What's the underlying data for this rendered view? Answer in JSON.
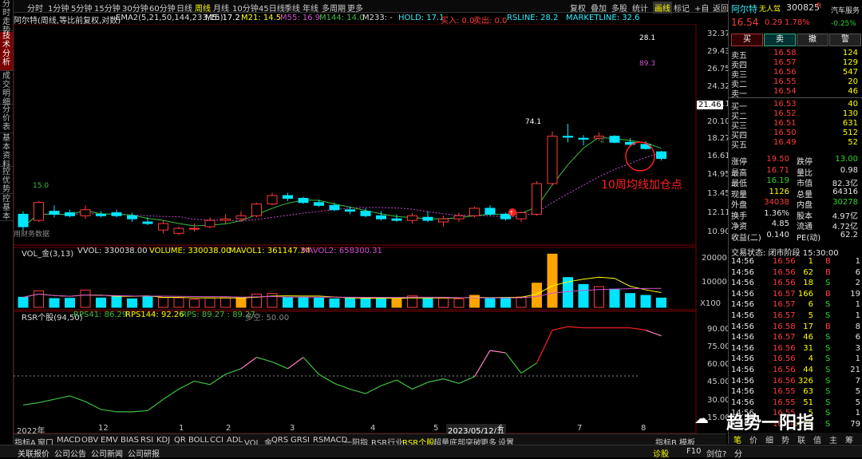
{
  "left_tabs": [
    {
      "label": "分时走势",
      "active": false
    },
    {
      "label": "技术分析",
      "active": true
    },
    {
      "label": "成交明细",
      "active": false
    },
    {
      "label": "分价表",
      "active": false
    },
    {
      "label": "基本资料",
      "active": false
    },
    {
      "label": "控优势",
      "active": false
    },
    {
      "label": "控基本",
      "active": false
    }
  ],
  "toolbar": {
    "periods": [
      "分时",
      "1分钟",
      "5分钟",
      "15分钟",
      "30分钟",
      "60分钟",
      "日线",
      "周线",
      "月线",
      "10分钟",
      "45日线",
      "季线",
      "年线",
      "多周期",
      "更多"
    ],
    "selected_period": "周线",
    "right_buttons": [
      "复权",
      "叠加",
      "多股",
      "统计",
      "画线",
      "标记",
      "+自",
      "返回"
    ]
  },
  "info": {
    "stock": "阿尔特(周线,等比前复权,对数)",
    "ema": "EMA2(5,21,50,144,233,15)",
    "m5": "M5: 17.2",
    "m21": "M21: 14.5",
    "m55": "M55: 16.9",
    "m144": "M144: 14.0",
    "m233": "M233: -",
    "hold": "HOLD: 17.1",
    "buy": "买入: 0.0",
    "sell": "卖出: 0.0",
    "rsline": "RSLINE: 28.2",
    "marketline": "MARKETLINE: 32.6"
  },
  "annotations": {
    "top_val1": "28.1",
    "top_val2": "89.3",
    "peak": "74.1",
    "left_label": "15.0",
    "watermark": "用财务数据",
    "callout": "10周均线加仓点",
    "current_price": "21.46",
    "current_price2": "16.61"
  },
  "price_axis": [
    "32.37",
    "29.43",
    "26.75",
    "24.32",
    "22.11",
    "20.10",
    "18.27",
    "16.61",
    "14.95",
    "13.45",
    "12.11",
    "10.90"
  ],
  "vol_info": {
    "name": "VOL_金(3,13)",
    "vvol": "VVOL: 330038.00",
    "volume": "VOLUME: 330038.00",
    "mavol1": "MAVOL1: 361147.34",
    "mavol2": "MAVOL2: 658300.31"
  },
  "vol_axis": [
    "20000",
    "10000",
    "X100"
  ],
  "rsr_info": {
    "name": "RSR个股(94,50)",
    "rps41": "RPS41: 86.29",
    "rps144": "RPS144: 92.26",
    "rps": "RPS: 89.27 : 89.27",
    "ref": "多空: 50.00"
  },
  "rsr_axis": [
    "90.00",
    "75.00",
    "60.00",
    "45.00",
    "30.00",
    "15.00"
  ],
  "time_axis": [
    "2022年",
    "12",
    "1",
    "2",
    "3",
    "4",
    "5",
    "2023/05/12/五",
    "6",
    "7",
    "8"
  ],
  "ind_tabs": [
    "指标A",
    "窗口",
    "MACD",
    "OBV",
    "EMV",
    "BIAS",
    "RSI",
    "KDJ",
    "QR",
    "BOLL",
    "CCI",
    "ADL",
    "VOL_金",
    "QRS",
    "GRSI",
    "RSMACD",
    "一阳指",
    "RSR行业",
    "RSR个股",
    "超量底部突破",
    "更多",
    "设置"
  ],
  "ind_tabs_selected": "RSR个股",
  "ind_right": [
    "指标B",
    "模板"
  ],
  "quote": {
    "name": "阿尔特",
    "tag": "无人驾",
    "code": "300825",
    "r_mark": "R",
    "sector": "汽车服务",
    "sector_chg": "-0.25%",
    "price": "16.54",
    "change": "0.29",
    "pct": "1.78%",
    "trade_buttons": [
      "买",
      "卖",
      "撤",
      "警"
    ],
    "sells": [
      {
        "label": "卖五",
        "price": "16.58",
        "vol": "124"
      },
      {
        "label": "卖四",
        "price": "16.57",
        "vol": "129"
      },
      {
        "label": "卖三",
        "price": "16.56",
        "vol": "547"
      },
      {
        "label": "卖二",
        "price": "16.55",
        "vol": "20"
      },
      {
        "label": "卖一",
        "price": "16.54",
        "vol": "46"
      }
    ],
    "buys": [
      {
        "label": "买一",
        "price": "16.53",
        "vol": "40"
      },
      {
        "label": "买二",
        "price": "16.52",
        "vol": "130"
      },
      {
        "label": "买三",
        "price": "16.51",
        "vol": "631"
      },
      {
        "label": "买四",
        "price": "16.50",
        "vol": "512"
      },
      {
        "label": "买五",
        "price": "16.49",
        "vol": "52"
      }
    ],
    "stats": [
      {
        "l1": "涨停",
        "v1": "19.50",
        "l2": "跌停",
        "v2": "13.00",
        "c1": "red",
        "c2": "grn"
      },
      {
        "l1": "最高",
        "v1": "16.71",
        "l2": "量比",
        "v2": "0.98",
        "c1": "red",
        "c2": "wht"
      },
      {
        "l1": "最低",
        "v1": "16.19",
        "l2": "市值",
        "v2": "82.3亿",
        "c1": "grn",
        "c2": "wht"
      },
      {
        "l1": "现量",
        "v1": "1126",
        "l2": "总量",
        "v2": "64316",
        "c1": "yel",
        "c2": "wht"
      },
      {
        "l1": "外盘",
        "v1": "34038",
        "l2": "内盘",
        "v2": "30278",
        "c1": "red",
        "c2": "grn"
      },
      {
        "l1": "换手",
        "v1": "1.36%",
        "l2": "股本",
        "v2": "4.97亿",
        "c1": "wht",
        "c2": "wht"
      },
      {
        "l1": "净资",
        "v1": "4.85",
        "l2": "流通",
        "v2": "4.72亿",
        "c1": "wht",
        "c2": "wht"
      },
      {
        "l1": "收益(二)",
        "v1": "0.140",
        "l2": "PE(动)",
        "v2": "62.2",
        "c1": "wht",
        "c2": "wht"
      }
    ],
    "trade_status": "交易状态: 闭市阶段 15:30:00",
    "ticks": [
      {
        "t": "14:56",
        "p": "16.56",
        "v": "1",
        "s": "B",
        "n": "1"
      },
      {
        "t": "14:56",
        "p": "16.56",
        "v": "62",
        "s": "B",
        "n": "6"
      },
      {
        "t": "14:56",
        "p": "16.56",
        "v": "18",
        "s": "S",
        "n": "2"
      },
      {
        "t": "14:56",
        "p": "16.57",
        "v": "166",
        "s": "B",
        "n": "19"
      },
      {
        "t": "14:56",
        "p": "16.57",
        "v": "6",
        "s": "S",
        "n": "1"
      },
      {
        "t": "14:56",
        "p": "16.57",
        "v": "5",
        "s": "S",
        "n": "1"
      },
      {
        "t": "14:56",
        "p": "16.58",
        "v": "17",
        "s": "B",
        "n": "8"
      },
      {
        "t": "14:56",
        "p": "16.57",
        "v": "46",
        "s": "S",
        "n": "6"
      },
      {
        "t": "14:56",
        "p": "16.56",
        "v": "31",
        "s": "S",
        "n": "3"
      },
      {
        "t": "14:56",
        "p": "16.56",
        "v": "4",
        "s": "S",
        "n": "1"
      },
      {
        "t": "14:56",
        "p": "16.56",
        "v": "44",
        "s": "S",
        "n": "21"
      },
      {
        "t": "14:56",
        "p": "16.56",
        "v": "326",
        "s": "S",
        "n": "7"
      },
      {
        "t": "14:56",
        "p": "16.55",
        "v": "63",
        "s": "S",
        "n": "5"
      },
      {
        "t": "14:56",
        "p": "16.55",
        "v": "51",
        "s": "S",
        "n": "5"
      },
      {
        "t": "14:56",
        "p": "16.55",
        "v": "5",
        "s": "S",
        "n": "1"
      },
      {
        "t": "15:00",
        "p": "16.54",
        "v": "1126",
        "s": "S",
        "n": "79"
      }
    ],
    "bottom_tabs": [
      "笔",
      "价",
      "细",
      "势",
      "联",
      "值",
      "主",
      "筹"
    ]
  },
  "status": {
    "items": [
      "关联报价",
      "公司公告",
      "公司新闻",
      "公司研报"
    ],
    "right": [
      "诊股",
      "F10",
      "剑位?",
      "分"
    ]
  },
  "watermark_account": "趋势一阳指",
  "colors": {
    "up": "#ff3b3b",
    "down": "#00e5ff",
    "vol_hl": "#ffa500",
    "ma10": "#c050d0",
    "ma_green": "#3fbf3f",
    "rps_green": "#3fbf3f",
    "rps_pink": "#ff80c0",
    "rps_red": "#ff2020"
  },
  "chart_data": {
    "type": "candlestick",
    "weeks": [
      "2022-11-04",
      "2022-11-11",
      "2022-11-18",
      "2022-11-25",
      "2022-12-02",
      "2022-12-09",
      "2022-12-16",
      "2022-12-23",
      "2022-12-30",
      "2023-01-06",
      "2023-01-13",
      "2023-01-20",
      "2023-02-03",
      "2023-02-10",
      "2023-02-17",
      "2023-02-24",
      "2023-03-03",
      "2023-03-10",
      "2023-03-17",
      "2023-03-24",
      "2023-03-31",
      "2023-04-07",
      "2023-04-14",
      "2023-04-21",
      "2023-04-28",
      "2023-05-05",
      "2023-05-12",
      "2023-05-19",
      "2023-05-26",
      "2023-06-02",
      "2023-06-09",
      "2023-06-16",
      "2023-06-21",
      "2023-06-30",
      "2023-07-07",
      "2023-07-14",
      "2023-07-21",
      "2023-07-28",
      "2023-08-04",
      "2023-08-11",
      "2023-08-18",
      "2023-08-25"
    ],
    "ohlc": [
      [
        12.4,
        12.6,
        11.4,
        11.6
      ],
      [
        12.0,
        13.3,
        11.9,
        13.2
      ],
      [
        12.6,
        13.0,
        12.2,
        12.4
      ],
      [
        12.5,
        12.7,
        12.2,
        12.3
      ],
      [
        12.3,
        13.0,
        12.1,
        12.7
      ],
      [
        12.4,
        12.6,
        12.2,
        12.3
      ],
      [
        12.5,
        12.7,
        12.2,
        12.3
      ],
      [
        12.3,
        12.5,
        11.9,
        12.1
      ],
      [
        11.9,
        12.2,
        11.7,
        11.8
      ],
      [
        11.4,
        12.0,
        11.2,
        11.8
      ],
      [
        11.2,
        11.6,
        11.1,
        11.5
      ],
      [
        11.5,
        11.8,
        11.3,
        11.5
      ],
      [
        11.6,
        12.2,
        11.5,
        12.0
      ],
      [
        12.0,
        12.4,
        11.8,
        12.1
      ],
      [
        12.1,
        12.6,
        11.9,
        12.3
      ],
      [
        12.3,
        13.2,
        12.2,
        13.1
      ],
      [
        13.1,
        13.9,
        13.0,
        13.7
      ],
      [
        13.7,
        13.9,
        13.3,
        13.5
      ],
      [
        13.5,
        13.6,
        13.1,
        13.2
      ],
      [
        13.2,
        13.4,
        12.9,
        13.0
      ],
      [
        13.0,
        13.2,
        12.6,
        12.7
      ],
      [
        12.7,
        12.9,
        12.4,
        12.6
      ],
      [
        12.6,
        12.8,
        12.2,
        12.3
      ],
      [
        12.3,
        12.6,
        12.0,
        12.1
      ],
      [
        12.1,
        12.4,
        11.9,
        12.0
      ],
      [
        12.0,
        12.5,
        11.8,
        12.3
      ],
      [
        12.2,
        12.6,
        11.9,
        12.0
      ],
      [
        11.9,
        12.3,
        11.6,
        12.1
      ],
      [
        12.1,
        12.5,
        11.9,
        12.3
      ],
      [
        12.3,
        12.9,
        12.2,
        12.8
      ],
      [
        12.8,
        13.0,
        12.3,
        12.4
      ],
      [
        12.4,
        12.5,
        12.0,
        12.1
      ],
      [
        12.1,
        12.6,
        11.9,
        12.5
      ],
      [
        12.4,
        14.8,
        12.3,
        14.6
      ],
      [
        14.6,
        19.3,
        14.5,
        18.8
      ],
      [
        18.8,
        20.1,
        18.2,
        18.7
      ],
      [
        18.6,
        18.9,
        17.9,
        18.5
      ],
      [
        18.6,
        19.2,
        18.4,
        18.8
      ],
      [
        18.8,
        18.9,
        18.1,
        18.2
      ],
      [
        18.2,
        18.6,
        17.9,
        18.0
      ],
      [
        18.0,
        18.3,
        17.5,
        17.6
      ],
      [
        17.3,
        17.4,
        16.5,
        16.7
      ]
    ],
    "volume": [
      3800,
      6200,
      3300,
      3400,
      6500,
      3500,
      4200,
      3200,
      4100,
      3700,
      3600,
      3000,
      3500,
      3900,
      3600,
      5000,
      5200,
      3800,
      3600,
      3500,
      3200,
      3700,
      3300,
      3400,
      3200,
      4300,
      3400,
      3500,
      3200,
      4500,
      3600,
      3700,
      3900,
      9100,
      20000,
      11200,
      8600,
      7800,
      6800,
      5200,
      4500,
      3500
    ],
    "rps": [
      28,
      30,
      33,
      36,
      31,
      24,
      22,
      22,
      23,
      33,
      42,
      49,
      46,
      55,
      60,
      70,
      66,
      60,
      70,
      55,
      47,
      42,
      38,
      45,
      50,
      42,
      48,
      51,
      47,
      53,
      76,
      74,
      56,
      65,
      94,
      97,
      96,
      96,
      96,
      96,
      94,
      89
    ]
  }
}
